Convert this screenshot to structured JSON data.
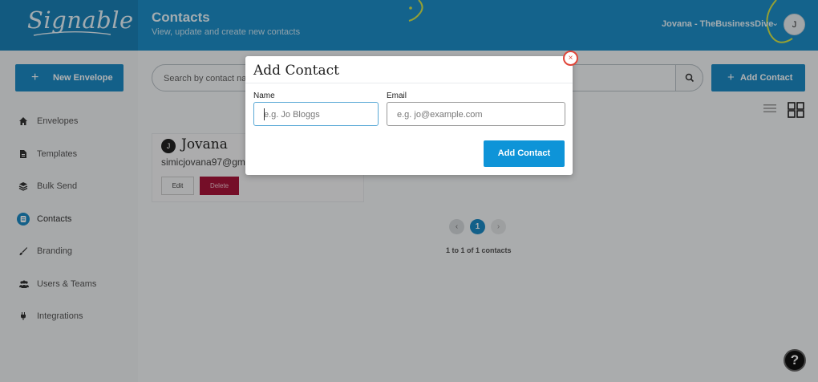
{
  "app": {
    "logo_text": "Signable",
    "brand_color": "#1e8fc9",
    "accent_color": "#1c8ac4"
  },
  "header": {
    "title": "Contacts",
    "subtitle": "View, update and create new contacts",
    "user_label": "Jovana - TheBusinessDive",
    "avatar_initial": "J"
  },
  "sidebar": {
    "new_envelope_label": "New Envelope",
    "items": [
      {
        "label": "Envelopes",
        "icon": "home-icon"
      },
      {
        "label": "Templates",
        "icon": "document-icon"
      },
      {
        "label": "Bulk Send",
        "icon": "layers-icon"
      },
      {
        "label": "Contacts",
        "icon": "contacts-icon",
        "active": true
      },
      {
        "label": "Branding",
        "icon": "brush-icon"
      },
      {
        "label": "Users & Teams",
        "icon": "users-icon"
      },
      {
        "label": "Integrations",
        "icon": "plug-icon"
      }
    ]
  },
  "main": {
    "search_placeholder": "Search by contact nam",
    "add_contact_label": "Add Contact",
    "contact_card": {
      "initial": "J",
      "name": "Jovana",
      "email": "simicjovana97@gm",
      "edit_label": "Edit",
      "delete_label": "Delete"
    },
    "pagination": {
      "prev": "‹",
      "current": "1",
      "next": "›",
      "summary": "1 to 1 of 1 contacts"
    },
    "help_label": "?"
  },
  "modal": {
    "title": "Add Contact",
    "close_symbol": "×",
    "name_label": "Name",
    "name_placeholder": "e.g. Jo Bloggs",
    "email_label": "Email",
    "email_placeholder": "e.g. jo@example.com",
    "submit_label": "Add Contact"
  }
}
